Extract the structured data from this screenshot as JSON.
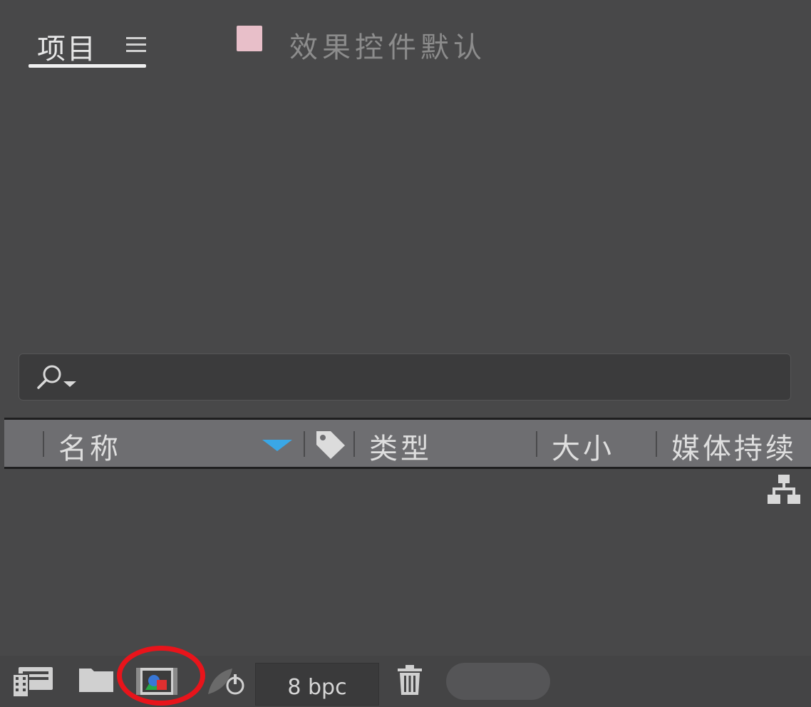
{
  "tabs": {
    "project": {
      "label": "项目"
    },
    "effects": {
      "label": "效果控件默认",
      "swatch_color": "#e8bfc9"
    }
  },
  "search": {
    "value": "",
    "placeholder": ""
  },
  "table": {
    "columns": [
      {
        "label": "名称"
      },
      {
        "label": "类型"
      },
      {
        "label": "大小"
      },
      {
        "label": "媒体持续"
      }
    ],
    "sort_indicator_color": "#3aa7e6"
  },
  "footer": {
    "bit_depth": "8 bpc"
  },
  "colors": {
    "background": "#484849",
    "header": "#6e6e71",
    "highlight_ring": "#e8141b"
  }
}
